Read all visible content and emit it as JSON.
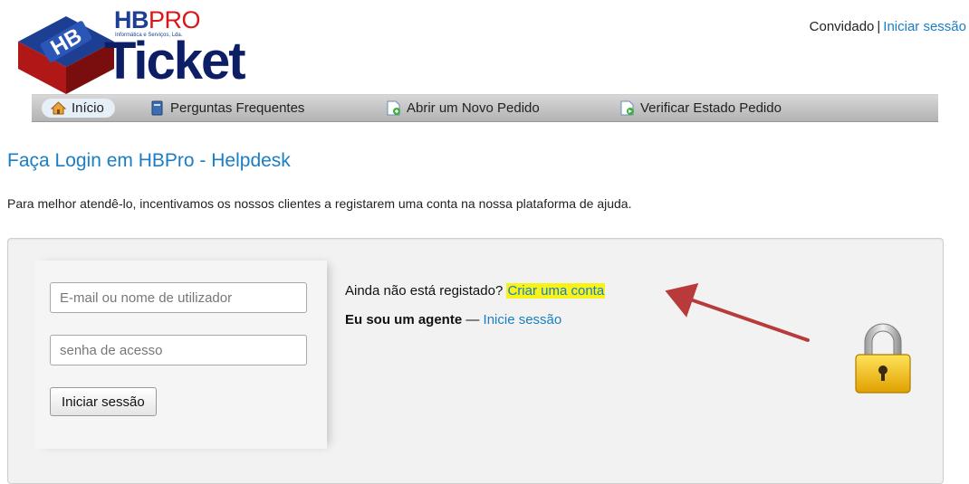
{
  "header": {
    "brand_hb": "HB",
    "brand_pro": "PRO",
    "brand_sub": "Informática e Serviços, Lda.",
    "brand_ticket": "Ticket",
    "logo_mark": "HB",
    "guest_label": "Convidado",
    "separator": "|",
    "login_link": "Iniciar sessão"
  },
  "nav": {
    "items": [
      {
        "label": "Início",
        "icon": "home-icon"
      },
      {
        "label": "Perguntas Frequentes",
        "icon": "book-icon"
      },
      {
        "label": "Abrir um Novo Pedido",
        "icon": "new-ticket-icon"
      },
      {
        "label": "Verificar Estado Pedido",
        "icon": "ticket-status-icon"
      }
    ]
  },
  "main": {
    "title": "Faça Login em HBPro - Helpdesk",
    "intro": "Para melhor atendê-lo, incentivamos os nossos clientes a registarem uma conta na nossa plataforma de ajuda."
  },
  "login": {
    "email_placeholder": "E-mail ou nome de utilizador",
    "password_placeholder": "senha de acesso",
    "submit_label": "Iniciar sessão",
    "register_prompt": "Ainda não está registado?",
    "register_link": "Criar uma conta",
    "agent_label": "Eu sou um agente",
    "agent_dash": "—",
    "agent_link": "Inicie sessão"
  },
  "colors": {
    "link": "#1a7ec4",
    "highlight": "#f6f21a",
    "arrow": "#b83a3a",
    "navbar": "#c4c4c4"
  }
}
